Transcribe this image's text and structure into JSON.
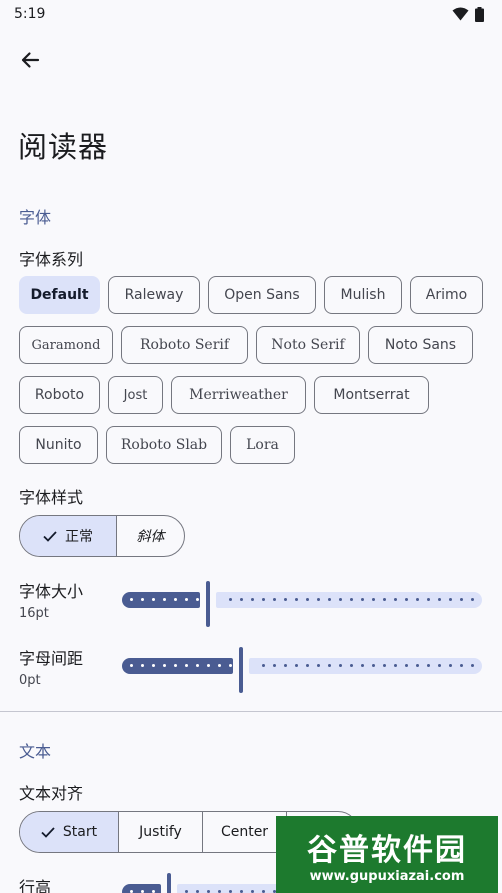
{
  "status_bar": {
    "time": "5:19"
  },
  "header": {
    "title": "阅读器"
  },
  "font_section": {
    "title": "字体",
    "family_label": "字体系列",
    "families": [
      {
        "label": "Default",
        "selected": true
      },
      {
        "label": "Raleway"
      },
      {
        "label": "Open Sans"
      },
      {
        "label": "Mulish"
      },
      {
        "label": "Arimo"
      },
      {
        "label": "Garamond"
      },
      {
        "label": "Roboto Serif"
      },
      {
        "label": "Noto Serif"
      },
      {
        "label": "Noto Sans"
      },
      {
        "label": "Roboto"
      },
      {
        "label": "Jost"
      },
      {
        "label": "Merriweather"
      },
      {
        "label": "Montserrat"
      },
      {
        "label": "Nunito"
      },
      {
        "label": "Roboto Slab"
      },
      {
        "label": "Lora"
      }
    ],
    "style_label": "字体样式",
    "styles": [
      {
        "label": "正常",
        "selected": true
      },
      {
        "label": "斜体"
      }
    ],
    "size_label": "字体大小",
    "size_value": "16pt",
    "size_fraction": 0.24,
    "spacing_label": "字母间距",
    "spacing_value": "0pt",
    "spacing_fraction": 0.33
  },
  "text_section": {
    "title": "文本",
    "align_label": "文本对齐",
    "aligns": [
      {
        "label": "Start",
        "selected": true
      },
      {
        "label": "Justify"
      },
      {
        "label": "Center"
      }
    ],
    "line_height_label": "行高"
  },
  "watermark": {
    "line1": "谷普软件园",
    "line2": "www.gupuxiazai.com"
  },
  "colors": {
    "primary": "#4a5c92",
    "primary_container": "#dce2f9",
    "background": "#f9f9fc",
    "outline": "#757780"
  }
}
